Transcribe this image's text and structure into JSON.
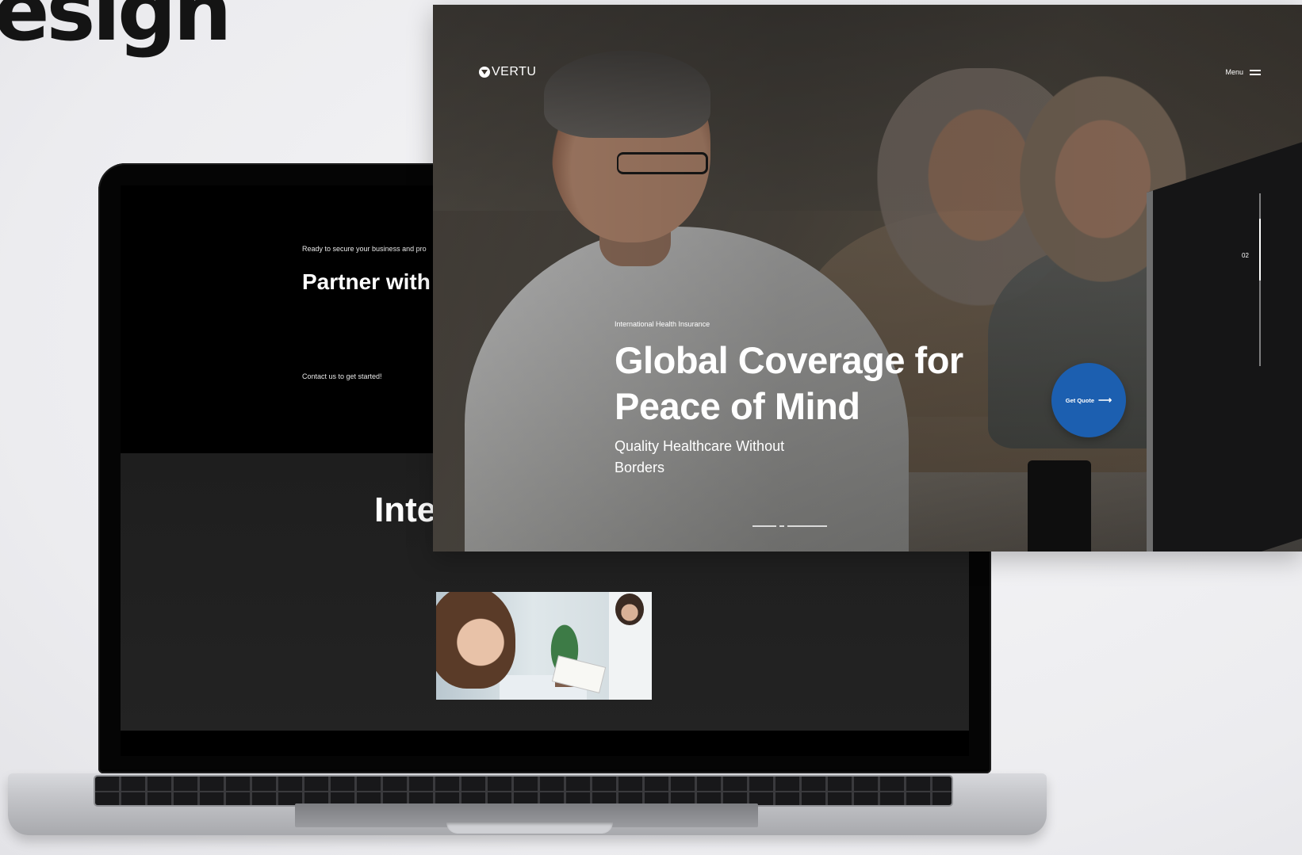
{
  "heading": "esign",
  "laptop": {
    "eyebrow": "Ready to secure your business and pro",
    "title": "Partner with today for re property an",
    "contact": "Contact us to get started!",
    "section_title": "Inte insurance"
  },
  "hero": {
    "logo": "VERTU",
    "menu": "Menu",
    "slide_number": "02",
    "eyebrow": "International Health Insurance",
    "title": "Global Coverage for Peace of Mind",
    "subtitle": "Quality Healthcare Without Borders",
    "cta": "Get Quote",
    "accent_color": "#1c5fb0"
  }
}
